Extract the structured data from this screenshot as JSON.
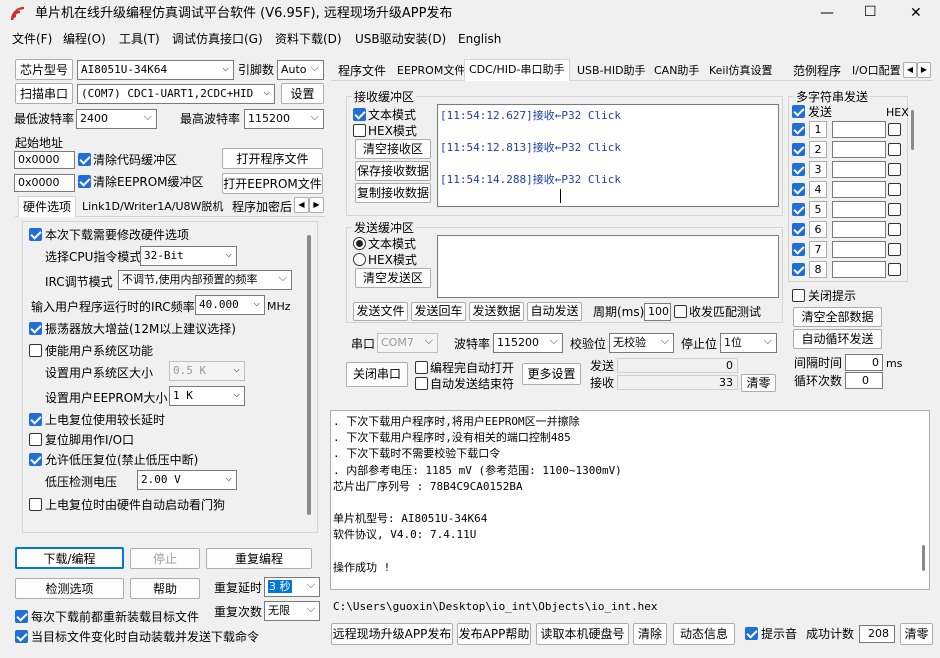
{
  "window": {
    "title": "单片机在线升级编程仿真调试平台软件 (V6.95F), 远程现场升级APP发布",
    "min": "—",
    "max": "☐",
    "close": "✕"
  },
  "menu": [
    "文件(F)",
    "编程(O)",
    "工具(T)",
    "调试仿真接口(G)",
    "资料下载(D)",
    "USB驱动安装(D)",
    "English"
  ],
  "left": {
    "chip_label": "芯片型号",
    "chip_value": "AI8051U-34K64",
    "pin_label": "引脚数",
    "pin_value": "Auto",
    "scan_label": "扫描串口",
    "port_value": "(COM7) CDC1-UART1,2CDC+HID",
    "settings_label": "设置",
    "min_baud_label": "最低波特率",
    "min_baud": "2400",
    "max_baud_label": "最高波特率",
    "max_baud": "115200",
    "start_addr_label": "起始地址",
    "addr1": "0x0000",
    "clear_code": "清除代码缓冲区",
    "open_prog": "打开程序文件",
    "addr2": "0x0000",
    "clear_eeprom": "清除EEPROM缓冲区",
    "open_eeprom": "打开EEPROM文件",
    "tabs": [
      "硬件选项",
      "Link1D/Writer1A/U8W脱机",
      "程序加密后"
    ],
    "hw": {
      "opt1": "本次下载需要修改硬件选项",
      "cpu_label": "选择CPU指令模式",
      "cpu_value": "32-Bit",
      "irc_label": "IRC调节模式",
      "irc_value": "不调节,使用内部预置的频率",
      "freq_label": "输入用户程序运行时的IRC频率",
      "freq_value": "40.000",
      "freq_unit": "MHz",
      "osc": "振荡器放大增益(12M以上建议选择)",
      "sysarea": "使能用户系统区功能",
      "sysarea_size_label": "设置用户系统区大小",
      "sysarea_size": "0.5 K",
      "eeprom_size_label": "设置用户EEPROM大小",
      "eeprom_size": "1   K",
      "reset_delay": "上电复位使用较长延时",
      "reset_io": "复位脚用作I/O口",
      "low_volt": "允许低压复位(禁止低压中断)",
      "volt_label": "低压检测电压",
      "volt_value": "2.00 V",
      "wdt": "上电复位时由硬件自动启动看门狗"
    },
    "download": "下载/编程",
    "stop": "停止",
    "reprogram": "重复编程",
    "check": "检测选项",
    "help": "帮助",
    "repeat_delay_label": "重复延时",
    "repeat_delay": "3 秒",
    "repeat_count_label": "重复次数",
    "repeat_count": "无限",
    "reload": "每次下载前都重新装载目标文件",
    "autoload": "当目标文件变化时自动装载并发送下载命令"
  },
  "right": {
    "tabs": [
      "程序文件",
      "EEPROM文件",
      "CDC/HID-串口助手",
      "USB-HID助手",
      "CAN助手",
      "Keil仿真设置",
      "范例程序",
      "I/O口配置"
    ],
    "rx_title": "接收缓冲区",
    "text_mode": "文本模式",
    "hex_mode": "HEX模式",
    "clear_rx": "清空接收区",
    "save_rx": "保存接收数据",
    "copy_rx": "复制接收数据",
    "rx_lines": [
      "[11:54:12.627]接收←P32 Click",
      "[11:54:12.813]接收←P32 Click",
      "[11:54:14.288]接收←P32 Click"
    ],
    "tx_title": "发送缓冲区",
    "tx_text_mode": "文本模式",
    "tx_hex_mode": "HEX模式",
    "clear_tx": "清空发送区",
    "send_file": "发送文件",
    "send_enter": "发送回车",
    "send_data": "发送数据",
    "auto_send": "自动发送",
    "period_label": "周期(ms)",
    "period": "100",
    "match": "收发匹配测试",
    "multi_title": "多字符串发送",
    "multi_send": "发送",
    "hex_col": "HEX",
    "rows": [
      "1",
      "2",
      "3",
      "4",
      "5",
      "6",
      "7",
      "8"
    ],
    "close_hint": "关闭提示",
    "clear_all": "清空全部数据",
    "auto_loop": "自动循环发送",
    "interval_label": "间隔时间",
    "interval": "0",
    "interval_unit": "ms",
    "loop_label": "循环次数",
    "loop": "0",
    "port_label": "串口",
    "port": "COM7",
    "baud_label": "波特率",
    "baud": "115200",
    "parity_label": "校验位",
    "parity": "无校验",
    "stop_label": "停止位",
    "stop": "1位",
    "close_port": "关闭串口",
    "auto_open": "编程完自动打开",
    "auto_close": "自动发送结束符",
    "more": "更多设置",
    "tx_count_label": "发送",
    "tx_count": "0",
    "rx_count_label": "接收",
    "rx_count": "33",
    "clear_count": "清零",
    "log": [
      "  . 下次下载用户程序时,将用户EEPROM区一并擦除",
      "  . 下次下载用户程序时,没有相关的端口控制485",
      "  . 下次下载时不需要校验下载口令",
      "  . 内部参考电压: 1185 mV (参考范围: 1100~1300mV)",
      "芯片出厂序列号 : 78B4C9CA0152BA",
      "",
      "  单片机型号: AI8051U-34K64",
      "  软件协议, V4.0: 7.4.11U",
      "",
      "操作成功 !"
    ],
    "path": "C:\\Users\\guoxin\\Desktop\\io_int\\Objects\\io_int.hex",
    "bottom": {
      "publish": "远程现场升级APP发布",
      "app_help": "发布APP帮助",
      "read_hdd": "读取本机硬盘号",
      "clear": "清除",
      "dynamic": "动态信息",
      "beep": "提示音",
      "success_label": "成功计数",
      "success": "208",
      "reset": "清零"
    }
  }
}
